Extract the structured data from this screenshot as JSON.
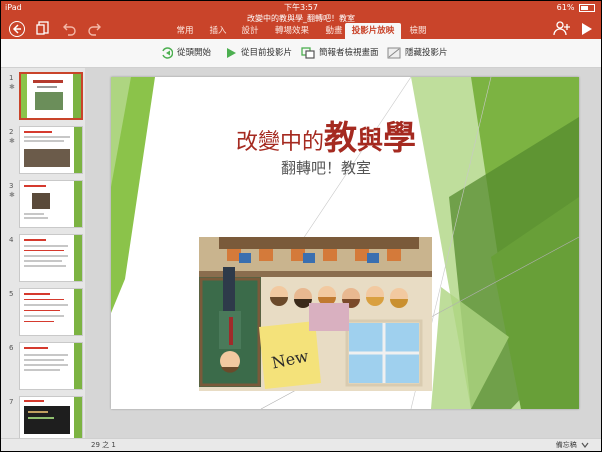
{
  "status": {
    "device": "iPad",
    "time": "下午3:57",
    "battery": "61%"
  },
  "document": {
    "title": "改變中的教與學_翻轉吧！教室"
  },
  "tabs": [
    {
      "label": "常用"
    },
    {
      "label": "插入"
    },
    {
      "label": "設計"
    },
    {
      "label": "轉場效果"
    },
    {
      "label": "動畫"
    },
    {
      "label": "投影片放映",
      "active": true
    },
    {
      "label": "檢閱"
    }
  ],
  "ribbon": {
    "from_start": "從頭開始",
    "from_current": "從目前投影片",
    "presenter_view": "簡報者檢視畫面",
    "hide_slide": "隱藏投影片"
  },
  "thumbnails": [
    {
      "num": "1",
      "star": "✱"
    },
    {
      "num": "2",
      "star": "✱"
    },
    {
      "num": "3",
      "star": "✱"
    },
    {
      "num": "4",
      "star": ""
    },
    {
      "num": "5",
      "star": ""
    },
    {
      "num": "6",
      "star": ""
    },
    {
      "num": "7",
      "star": ""
    }
  ],
  "slide": {
    "title_a": "改變中的",
    "title_b": "教",
    "title_c": "與",
    "title_d": "學",
    "subtitle": "翻轉吧！教室"
  },
  "footer": {
    "page_info": "29 之 1",
    "notes_label": "備忘稿"
  },
  "colors": {
    "accent": "#c9442a",
    "slide_green": "#7cb342",
    "title_red": "#a52a20"
  }
}
